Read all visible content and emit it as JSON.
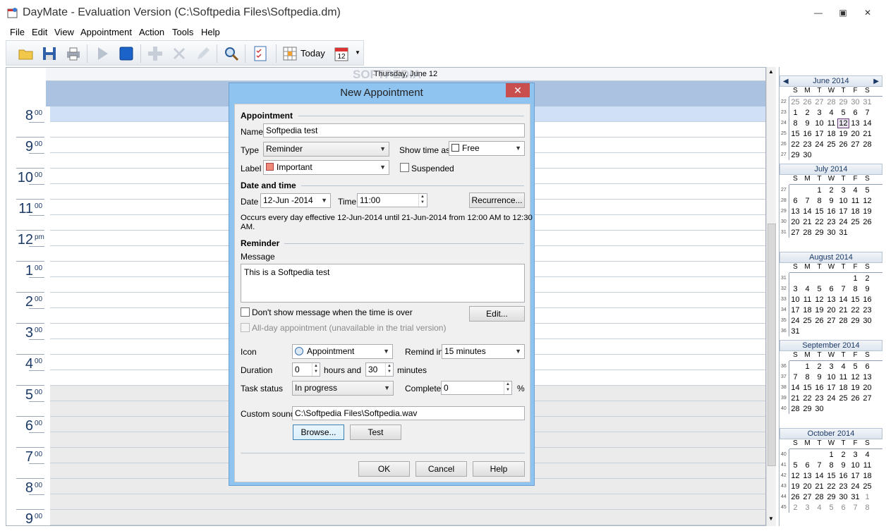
{
  "window": {
    "title": "DayMate - Evaluation Version (C:\\Softpedia Files\\Softpedia.dm)"
  },
  "menu": [
    "File",
    "Edit",
    "View",
    "Appointment",
    "Action",
    "Tools",
    "Help"
  ],
  "toolbar": {
    "today_label": "Today",
    "calendar_badge": "12"
  },
  "calendar": {
    "day_header": "Thursday, June 12",
    "hours": [
      {
        "h": "8",
        "s": "00"
      },
      {
        "h": "9",
        "s": "00"
      },
      {
        "h": "10",
        "s": "00"
      },
      {
        "h": "11",
        "s": "00"
      },
      {
        "h": "12",
        "s": "pm"
      },
      {
        "h": "1",
        "s": "00"
      },
      {
        "h": "2",
        "s": "00"
      },
      {
        "h": "3",
        "s": "00"
      },
      {
        "h": "4",
        "s": "00"
      },
      {
        "h": "5",
        "s": "00"
      },
      {
        "h": "6",
        "s": "00"
      },
      {
        "h": "7",
        "s": "00"
      },
      {
        "h": "8",
        "s": "00"
      },
      {
        "h": "9",
        "s": "00"
      }
    ]
  },
  "watermark": "SOFTPEDIA",
  "mini_calendar": {
    "dow": [
      "S",
      "M",
      "T",
      "W",
      "T",
      "F",
      "S"
    ],
    "months": [
      {
        "name": "June 2014",
        "weeks": [
          {
            "wk": "22",
            "days": [
              "25",
              "26",
              "27",
              "28",
              "29",
              "30",
              "31"
            ]
          },
          {
            "wk": "23",
            "days": [
              "1",
              "2",
              "3",
              "4",
              "5",
              "6",
              "7"
            ]
          },
          {
            "wk": "24",
            "days": [
              "8",
              "9",
              "10",
              "11",
              "12",
              "13",
              "14"
            ]
          },
          {
            "wk": "25",
            "days": [
              "15",
              "16",
              "17",
              "18",
              "19",
              "20",
              "21"
            ]
          },
          {
            "wk": "26",
            "days": [
              "22",
              "23",
              "24",
              "25",
              "26",
              "27",
              "28"
            ]
          },
          {
            "wk": "27",
            "days": [
              "29",
              "30",
              "",
              "",
              "",
              "",
              ""
            ]
          }
        ]
      },
      {
        "name": "July 2014",
        "weeks": [
          {
            "wk": "27",
            "days": [
              "",
              "",
              "1",
              "2",
              "3",
              "4",
              "5"
            ]
          },
          {
            "wk": "28",
            "days": [
              "6",
              "7",
              "8",
              "9",
              "10",
              "11",
              "12"
            ]
          },
          {
            "wk": "29",
            "days": [
              "13",
              "14",
              "15",
              "16",
              "17",
              "18",
              "19"
            ]
          },
          {
            "wk": "30",
            "days": [
              "20",
              "21",
              "22",
              "23",
              "24",
              "25",
              "26"
            ]
          },
          {
            "wk": "31",
            "days": [
              "27",
              "28",
              "29",
              "30",
              "31",
              "",
              ""
            ]
          }
        ]
      },
      {
        "name": "August 2014",
        "weeks": [
          {
            "wk": "31",
            "days": [
              "",
              "",
              "",
              "",
              "",
              "1",
              "2"
            ]
          },
          {
            "wk": "32",
            "days": [
              "3",
              "4",
              "5",
              "6",
              "7",
              "8",
              "9"
            ]
          },
          {
            "wk": "33",
            "days": [
              "10",
              "11",
              "12",
              "13",
              "14",
              "15",
              "16"
            ]
          },
          {
            "wk": "34",
            "days": [
              "17",
              "18",
              "19",
              "20",
              "21",
              "22",
              "23"
            ]
          },
          {
            "wk": "35",
            "days": [
              "24",
              "25",
              "26",
              "27",
              "28",
              "29",
              "30"
            ]
          },
          {
            "wk": "36",
            "days": [
              "31",
              "",
              "",
              "",
              "",
              "",
              ""
            ]
          }
        ]
      },
      {
        "name": "September 2014",
        "weeks": [
          {
            "wk": "36",
            "days": [
              "",
              "1",
              "2",
              "3",
              "4",
              "5",
              "6"
            ]
          },
          {
            "wk": "37",
            "days": [
              "7",
              "8",
              "9",
              "10",
              "11",
              "12",
              "13"
            ]
          },
          {
            "wk": "38",
            "days": [
              "14",
              "15",
              "16",
              "17",
              "18",
              "19",
              "20"
            ]
          },
          {
            "wk": "39",
            "days": [
              "21",
              "22",
              "23",
              "24",
              "25",
              "26",
              "27"
            ]
          },
          {
            "wk": "40",
            "days": [
              "28",
              "29",
              "30",
              "",
              "",
              "",
              ""
            ]
          }
        ]
      },
      {
        "name": "October 2014",
        "weeks": [
          {
            "wk": "40",
            "days": [
              "",
              "",
              "",
              "1",
              "2",
              "3",
              "4"
            ]
          },
          {
            "wk": "41",
            "days": [
              "5",
              "6",
              "7",
              "8",
              "9",
              "10",
              "11"
            ]
          },
          {
            "wk": "42",
            "days": [
              "12",
              "13",
              "14",
              "15",
              "16",
              "17",
              "18"
            ]
          },
          {
            "wk": "43",
            "days": [
              "19",
              "20",
              "21",
              "22",
              "23",
              "24",
              "25"
            ]
          },
          {
            "wk": "44",
            "days": [
              "26",
              "27",
              "28",
              "29",
              "30",
              "31",
              "1"
            ]
          },
          {
            "wk": "45",
            "days": [
              "2",
              "3",
              "4",
              "5",
              "6",
              "7",
              "8"
            ]
          }
        ]
      }
    ]
  },
  "dialog": {
    "title": "New Appointment",
    "close": "✕",
    "appointment_section": "Appointment",
    "name_label": "Name",
    "name_value": "Softpedia test",
    "type_label": "Type",
    "type_value": "Reminder",
    "show_time_label": "Show time as",
    "show_time_value": "Free",
    "label_label": "Label",
    "label_value": "Important",
    "label_color": "#f08a7a",
    "suspended_label": "Suspended",
    "datetime_section": "Date and time",
    "date_label": "Date",
    "date_value": "12-Jun -2014",
    "time_label": "Time",
    "time_value": "11:00",
    "recurrence_button": "Recurrence...",
    "occurs_text_1": "Occurs every day effective 12-Jun-2014 until 21-Jun-2014 from 12:00 AM to 12:30",
    "occurs_text_2": "AM.",
    "reminder_section": "Reminder",
    "message_label": "Message",
    "message_value": "This is a Softpedia test",
    "dont_show_label": "Don't show message when the time is over",
    "edit_button": "Edit...",
    "allday_label": "All-day appointment (unavailable in the trial version)",
    "icon_label": "Icon",
    "icon_value": "Appointment",
    "remind_in_label": "Remind in",
    "remind_in_value": "15 minutes",
    "duration_label": "Duration",
    "duration_hours": "0",
    "hours_label": "hours",
    "and_label": "and",
    "duration_minutes": "30",
    "minutes_label": "minutes",
    "task_status_label": "Task status",
    "task_status_value": "In progress",
    "complete_label": "Complete",
    "complete_value": "0",
    "percent": "%",
    "custom_sound_label": "Custom sound",
    "custom_sound_value": "C:\\Softpedia Files\\Softpedia.wav",
    "browse_button": "Browse...",
    "test_button": "Test",
    "ok_button": "OK",
    "cancel_button": "Cancel",
    "help_button": "Help"
  }
}
